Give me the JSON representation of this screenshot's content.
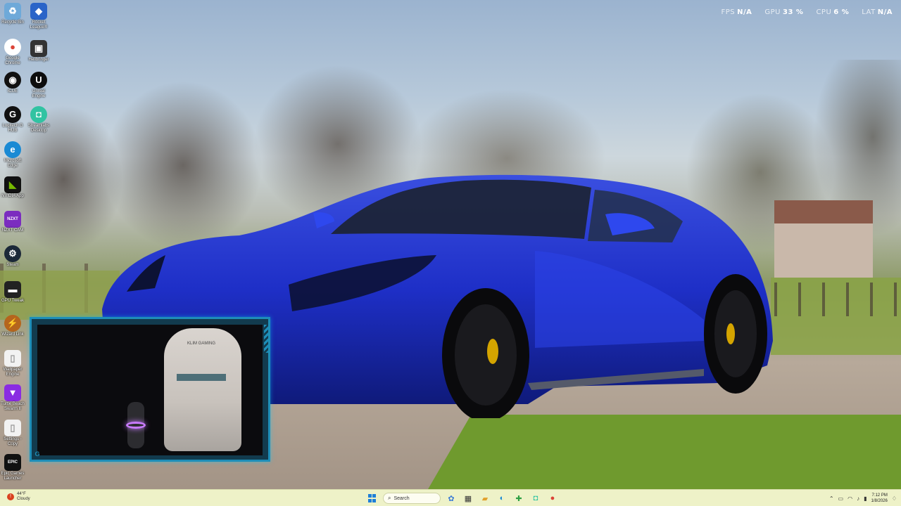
{
  "desktop": {
    "icons": [
      {
        "label": "Recycle Bin",
        "icon": "recycle-bin-icon",
        "glyph": "♻",
        "color": "#6ea9d9"
      },
      {
        "label": "Rocket League®",
        "icon": "rocket-league-icon",
        "glyph": "◆",
        "color": "#2a64c8"
      },
      {
        "label": "Google Chrome",
        "icon": "chrome-icon",
        "glyph": "●",
        "color": "#db4437"
      },
      {
        "label": "Hellbringer",
        "icon": "game-icon",
        "glyph": "▣",
        "color": "#333333"
      },
      {
        "label": "iCUE",
        "icon": "icue-icon",
        "glyph": "◉",
        "color": "#111111"
      },
      {
        "label": "Unreal Engine",
        "icon": "unreal-engine-icon",
        "glyph": "U",
        "color": "#0d0d0d"
      },
      {
        "label": "Logitech G HUB",
        "icon": "logitech-g-hub-icon",
        "glyph": "G",
        "color": "#111111"
      },
      {
        "label": "Streamlabs Desktop",
        "icon": "streamlabs-icon",
        "glyph": "◘",
        "color": "#31c3a2"
      },
      {
        "label": "Microsoft Edge",
        "icon": "edge-icon",
        "glyph": "e",
        "color": "#1a8ad4"
      },
      {
        "label": "NVIDIA App",
        "icon": "nvidia-icon",
        "glyph": "◣",
        "color": "#76b900"
      },
      {
        "label": "NZXT CAM",
        "icon": "nzxt-cam-icon",
        "glyph": "NZXT",
        "color": "#7b2cbf"
      },
      {
        "label": "Steam",
        "icon": "steam-icon",
        "glyph": "⚙",
        "color": "#1b2838"
      },
      {
        "label": "GPU Tweak",
        "icon": "gpu-tweak-icon",
        "glyph": "▬",
        "color": "#222222"
      },
      {
        "label": "Wizard Link",
        "icon": "wizard-link-icon",
        "glyph": "⚡",
        "color": "#b5651d"
      },
      {
        "label": "Wallpaper Engine",
        "icon": "document-icon",
        "glyph": "▯",
        "color": "#f2f2f2"
      },
      {
        "label": "Turtle Beach Swarm II",
        "icon": "turtle-beach-icon",
        "glyph": "▼",
        "color": "#8a2be2"
      },
      {
        "label": "Settings - Copy",
        "icon": "document-icon",
        "glyph": "▯",
        "color": "#f2f2f2"
      },
      {
        "label": "Epic Games Launcher",
        "icon": "epic-games-icon",
        "glyph": "EPIC",
        "color": "#111111"
      }
    ]
  },
  "perf": {
    "fps_label": "FPS",
    "fps_value": "N/A",
    "gpu_label": "GPU",
    "gpu_value": "33 %",
    "cpu_label": "CPU",
    "cpu_value": "6 %",
    "lat_label": "LAT",
    "lat_value": "N/A"
  },
  "webcam": {
    "chair_brand": "KLIM GAMING",
    "logo": "G"
  },
  "taskbar": {
    "weather_temp": "44°F",
    "weather_desc": "Cloudy",
    "search_placeholder": "Search",
    "time": "7:12 PM",
    "date": "1/8/2026",
    "tray_chevron": "⌃",
    "apps": [
      {
        "name": "copilot-icon",
        "glyph": "✿",
        "color": "#3b7bd6"
      },
      {
        "name": "file-explorer-icon",
        "glyph": "▦",
        "color": "#333333"
      },
      {
        "name": "folder-icon",
        "glyph": "▰",
        "color": "#e1a12c"
      },
      {
        "name": "edge-icon",
        "glyph": "◐",
        "color": "#1a8ad4"
      },
      {
        "name": "xbox-icon",
        "glyph": "✚",
        "color": "#2ea043"
      },
      {
        "name": "streamlabs-icon",
        "glyph": "◘",
        "color": "#31c3a2"
      },
      {
        "name": "chrome-icon",
        "glyph": "●",
        "color": "#db4437"
      }
    ]
  }
}
